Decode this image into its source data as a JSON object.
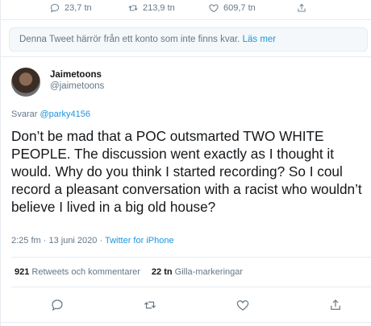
{
  "top_actions": {
    "replies": "23,7 tn",
    "retweets": "213,9 tn",
    "likes": "609,7 tn"
  },
  "notice": {
    "text": "Denna Tweet härrör från ett konto som inte finns kvar.",
    "link": "Läs mer"
  },
  "author": {
    "name": "Jaimetoons",
    "handle": "@jaimetoons"
  },
  "reply": {
    "prefix": "Svarar",
    "target": "@parky4156"
  },
  "tweet": {
    "text": "Don’t be mad that a POC outsmarted TWO WHITE PEOPLE. The discussion went exactly as I thought it would. Why do you think I started recording? So I coul record a pleasant conversation with a racist who wouldn’t believe I lived in a big old house?"
  },
  "meta": {
    "time": "2:25 fm · 13 juni 2020 ·",
    "source": "Twitter for iPhone"
  },
  "stats": {
    "retweets_count": "921",
    "retweets_label": "Retweets och kommentarer",
    "likes_count": "22 tn",
    "likes_label": "Gilla-markeringar"
  }
}
